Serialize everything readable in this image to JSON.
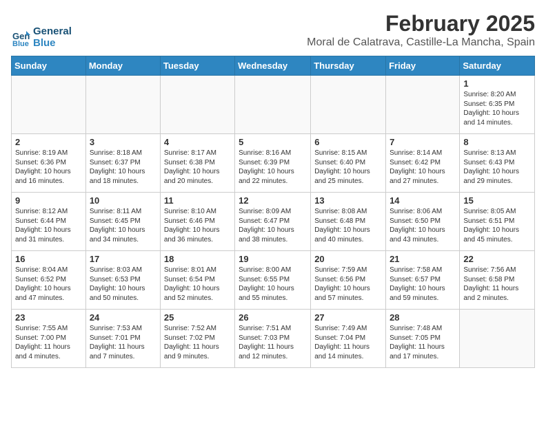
{
  "logo": {
    "line1": "General",
    "line2": "Blue"
  },
  "title": "February 2025",
  "location": "Moral de Calatrava, Castille-La Mancha, Spain",
  "weekdays": [
    "Sunday",
    "Monday",
    "Tuesday",
    "Wednesday",
    "Thursday",
    "Friday",
    "Saturday"
  ],
  "weeks": [
    [
      {
        "day": "",
        "info": ""
      },
      {
        "day": "",
        "info": ""
      },
      {
        "day": "",
        "info": ""
      },
      {
        "day": "",
        "info": ""
      },
      {
        "day": "",
        "info": ""
      },
      {
        "day": "",
        "info": ""
      },
      {
        "day": "1",
        "info": "Sunrise: 8:20 AM\nSunset: 6:35 PM\nDaylight: 10 hours\nand 14 minutes."
      }
    ],
    [
      {
        "day": "2",
        "info": "Sunrise: 8:19 AM\nSunset: 6:36 PM\nDaylight: 10 hours\nand 16 minutes."
      },
      {
        "day": "3",
        "info": "Sunrise: 8:18 AM\nSunset: 6:37 PM\nDaylight: 10 hours\nand 18 minutes."
      },
      {
        "day": "4",
        "info": "Sunrise: 8:17 AM\nSunset: 6:38 PM\nDaylight: 10 hours\nand 20 minutes."
      },
      {
        "day": "5",
        "info": "Sunrise: 8:16 AM\nSunset: 6:39 PM\nDaylight: 10 hours\nand 22 minutes."
      },
      {
        "day": "6",
        "info": "Sunrise: 8:15 AM\nSunset: 6:40 PM\nDaylight: 10 hours\nand 25 minutes."
      },
      {
        "day": "7",
        "info": "Sunrise: 8:14 AM\nSunset: 6:42 PM\nDaylight: 10 hours\nand 27 minutes."
      },
      {
        "day": "8",
        "info": "Sunrise: 8:13 AM\nSunset: 6:43 PM\nDaylight: 10 hours\nand 29 minutes."
      }
    ],
    [
      {
        "day": "9",
        "info": "Sunrise: 8:12 AM\nSunset: 6:44 PM\nDaylight: 10 hours\nand 31 minutes."
      },
      {
        "day": "10",
        "info": "Sunrise: 8:11 AM\nSunset: 6:45 PM\nDaylight: 10 hours\nand 34 minutes."
      },
      {
        "day": "11",
        "info": "Sunrise: 8:10 AM\nSunset: 6:46 PM\nDaylight: 10 hours\nand 36 minutes."
      },
      {
        "day": "12",
        "info": "Sunrise: 8:09 AM\nSunset: 6:47 PM\nDaylight: 10 hours\nand 38 minutes."
      },
      {
        "day": "13",
        "info": "Sunrise: 8:08 AM\nSunset: 6:48 PM\nDaylight: 10 hours\nand 40 minutes."
      },
      {
        "day": "14",
        "info": "Sunrise: 8:06 AM\nSunset: 6:50 PM\nDaylight: 10 hours\nand 43 minutes."
      },
      {
        "day": "15",
        "info": "Sunrise: 8:05 AM\nSunset: 6:51 PM\nDaylight: 10 hours\nand 45 minutes."
      }
    ],
    [
      {
        "day": "16",
        "info": "Sunrise: 8:04 AM\nSunset: 6:52 PM\nDaylight: 10 hours\nand 47 minutes."
      },
      {
        "day": "17",
        "info": "Sunrise: 8:03 AM\nSunset: 6:53 PM\nDaylight: 10 hours\nand 50 minutes."
      },
      {
        "day": "18",
        "info": "Sunrise: 8:01 AM\nSunset: 6:54 PM\nDaylight: 10 hours\nand 52 minutes."
      },
      {
        "day": "19",
        "info": "Sunrise: 8:00 AM\nSunset: 6:55 PM\nDaylight: 10 hours\nand 55 minutes."
      },
      {
        "day": "20",
        "info": "Sunrise: 7:59 AM\nSunset: 6:56 PM\nDaylight: 10 hours\nand 57 minutes."
      },
      {
        "day": "21",
        "info": "Sunrise: 7:58 AM\nSunset: 6:57 PM\nDaylight: 10 hours\nand 59 minutes."
      },
      {
        "day": "22",
        "info": "Sunrise: 7:56 AM\nSunset: 6:58 PM\nDaylight: 11 hours\nand 2 minutes."
      }
    ],
    [
      {
        "day": "23",
        "info": "Sunrise: 7:55 AM\nSunset: 7:00 PM\nDaylight: 11 hours\nand 4 minutes."
      },
      {
        "day": "24",
        "info": "Sunrise: 7:53 AM\nSunset: 7:01 PM\nDaylight: 11 hours\nand 7 minutes."
      },
      {
        "day": "25",
        "info": "Sunrise: 7:52 AM\nSunset: 7:02 PM\nDaylight: 11 hours\nand 9 minutes."
      },
      {
        "day": "26",
        "info": "Sunrise: 7:51 AM\nSunset: 7:03 PM\nDaylight: 11 hours\nand 12 minutes."
      },
      {
        "day": "27",
        "info": "Sunrise: 7:49 AM\nSunset: 7:04 PM\nDaylight: 11 hours\nand 14 minutes."
      },
      {
        "day": "28",
        "info": "Sunrise: 7:48 AM\nSunset: 7:05 PM\nDaylight: 11 hours\nand 17 minutes."
      },
      {
        "day": "",
        "info": ""
      }
    ]
  ]
}
